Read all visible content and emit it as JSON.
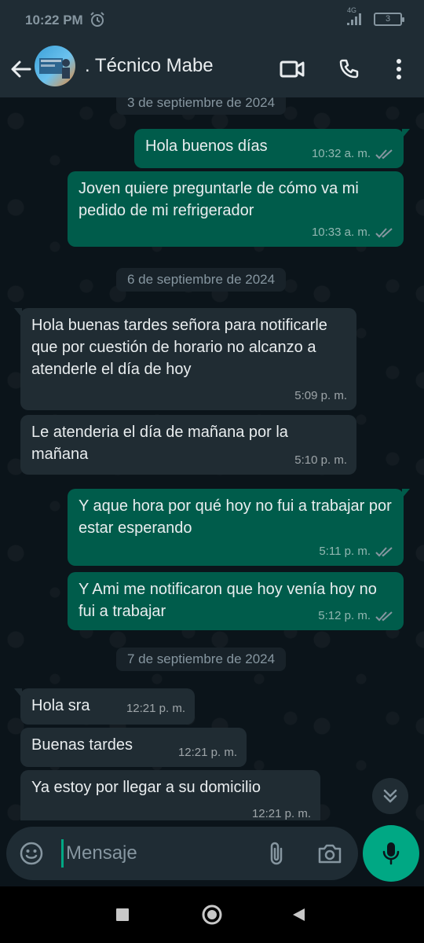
{
  "status_bar": {
    "time": "10:22 PM",
    "network": "4G",
    "battery_level": "3",
    "icons": [
      "alarm-icon",
      "signal-icon",
      "battery-icon"
    ]
  },
  "header": {
    "back_icon": "arrow-left-icon",
    "contact_name": ". Técnico Mabe",
    "actions": [
      "video-call-icon",
      "phone-icon",
      "more-vertical-icon"
    ]
  },
  "chat": {
    "dates": [
      "3 de septiembre de 2024",
      "6 de septiembre de 2024",
      "7 de septiembre de 2024"
    ],
    "messages": [
      {
        "dir": "out",
        "text": "Hola buenos días",
        "time": "10:32 a. m.",
        "status": "read"
      },
      {
        "dir": "out",
        "text": "Joven quiere preguntarle de cómo va mi pedido de mi refrigerador",
        "time": "10:33 a. m.",
        "status": "read"
      },
      {
        "dir": "in",
        "text": "Hola buenas tardes señora  para notificarle que por cuestión de horario no alcanzo a atenderle el día de hoy",
        "time": "5:09 p. m."
      },
      {
        "dir": "in",
        "text": "Le atenderia el día de mañana por la mañana",
        "time": "5:10 p. m."
      },
      {
        "dir": "out",
        "text": "Y aque hora por qué hoy no fui a trabajar por estar esperando",
        "time": "5:11 p. m.",
        "status": "read"
      },
      {
        "dir": "out",
        "text": "Y Ami me notificaron que hoy venía hoy no fui a trabajar",
        "time": "5:12 p. m.",
        "status": "read"
      },
      {
        "dir": "in",
        "text": "Hola sra",
        "time": "12:21 p. m."
      },
      {
        "dir": "in",
        "text": "Buenas tardes",
        "time": "12:21 p. m."
      },
      {
        "dir": "in",
        "text": "Ya estoy por llegar a su domicilio",
        "time": "12:21 p. m."
      }
    ]
  },
  "composer": {
    "placeholder": "Mensaje",
    "icons": [
      "emoji-icon",
      "attach-icon",
      "camera-icon",
      "mic-icon"
    ]
  },
  "colors": {
    "outgoing_bubble": "#005c4b",
    "incoming_bubble": "#202c33",
    "accent": "#00a884",
    "read_ticks": "#8696a0"
  }
}
